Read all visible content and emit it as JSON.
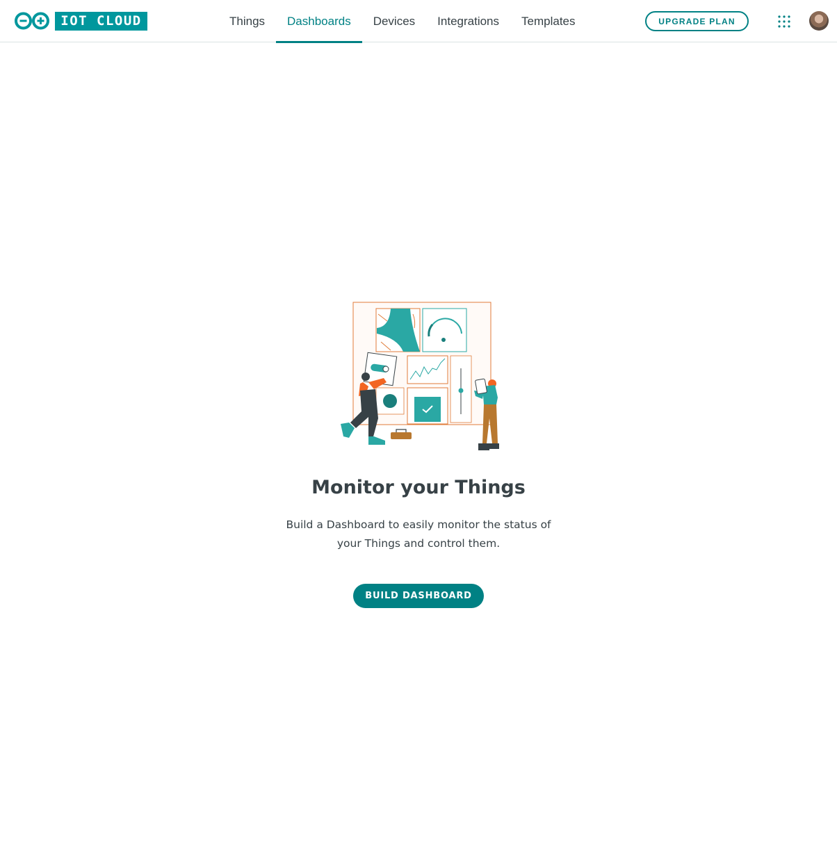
{
  "brand": {
    "name": "IOT CLOUD",
    "logo_icon": "arduino-infinity-logo",
    "accent_color": "#008184",
    "logo_color": "#00979d"
  },
  "nav": {
    "items": [
      {
        "label": "Things",
        "active": false
      },
      {
        "label": "Dashboards",
        "active": true
      },
      {
        "label": "Devices",
        "active": false
      },
      {
        "label": "Integrations",
        "active": false
      },
      {
        "label": "Templates",
        "active": false
      }
    ]
  },
  "header_actions": {
    "upgrade_label": "UPGRADE PLAN",
    "apps_icon": "grid-dots-icon",
    "avatar_icon": "user-avatar"
  },
  "empty_state": {
    "illustration": "dashboard-builders-illustration",
    "title": "Monitor your Things",
    "description": "Build a Dashboard to easily monitor the status of your Things and control them.",
    "button_label": "BUILD DASHBOARD"
  }
}
